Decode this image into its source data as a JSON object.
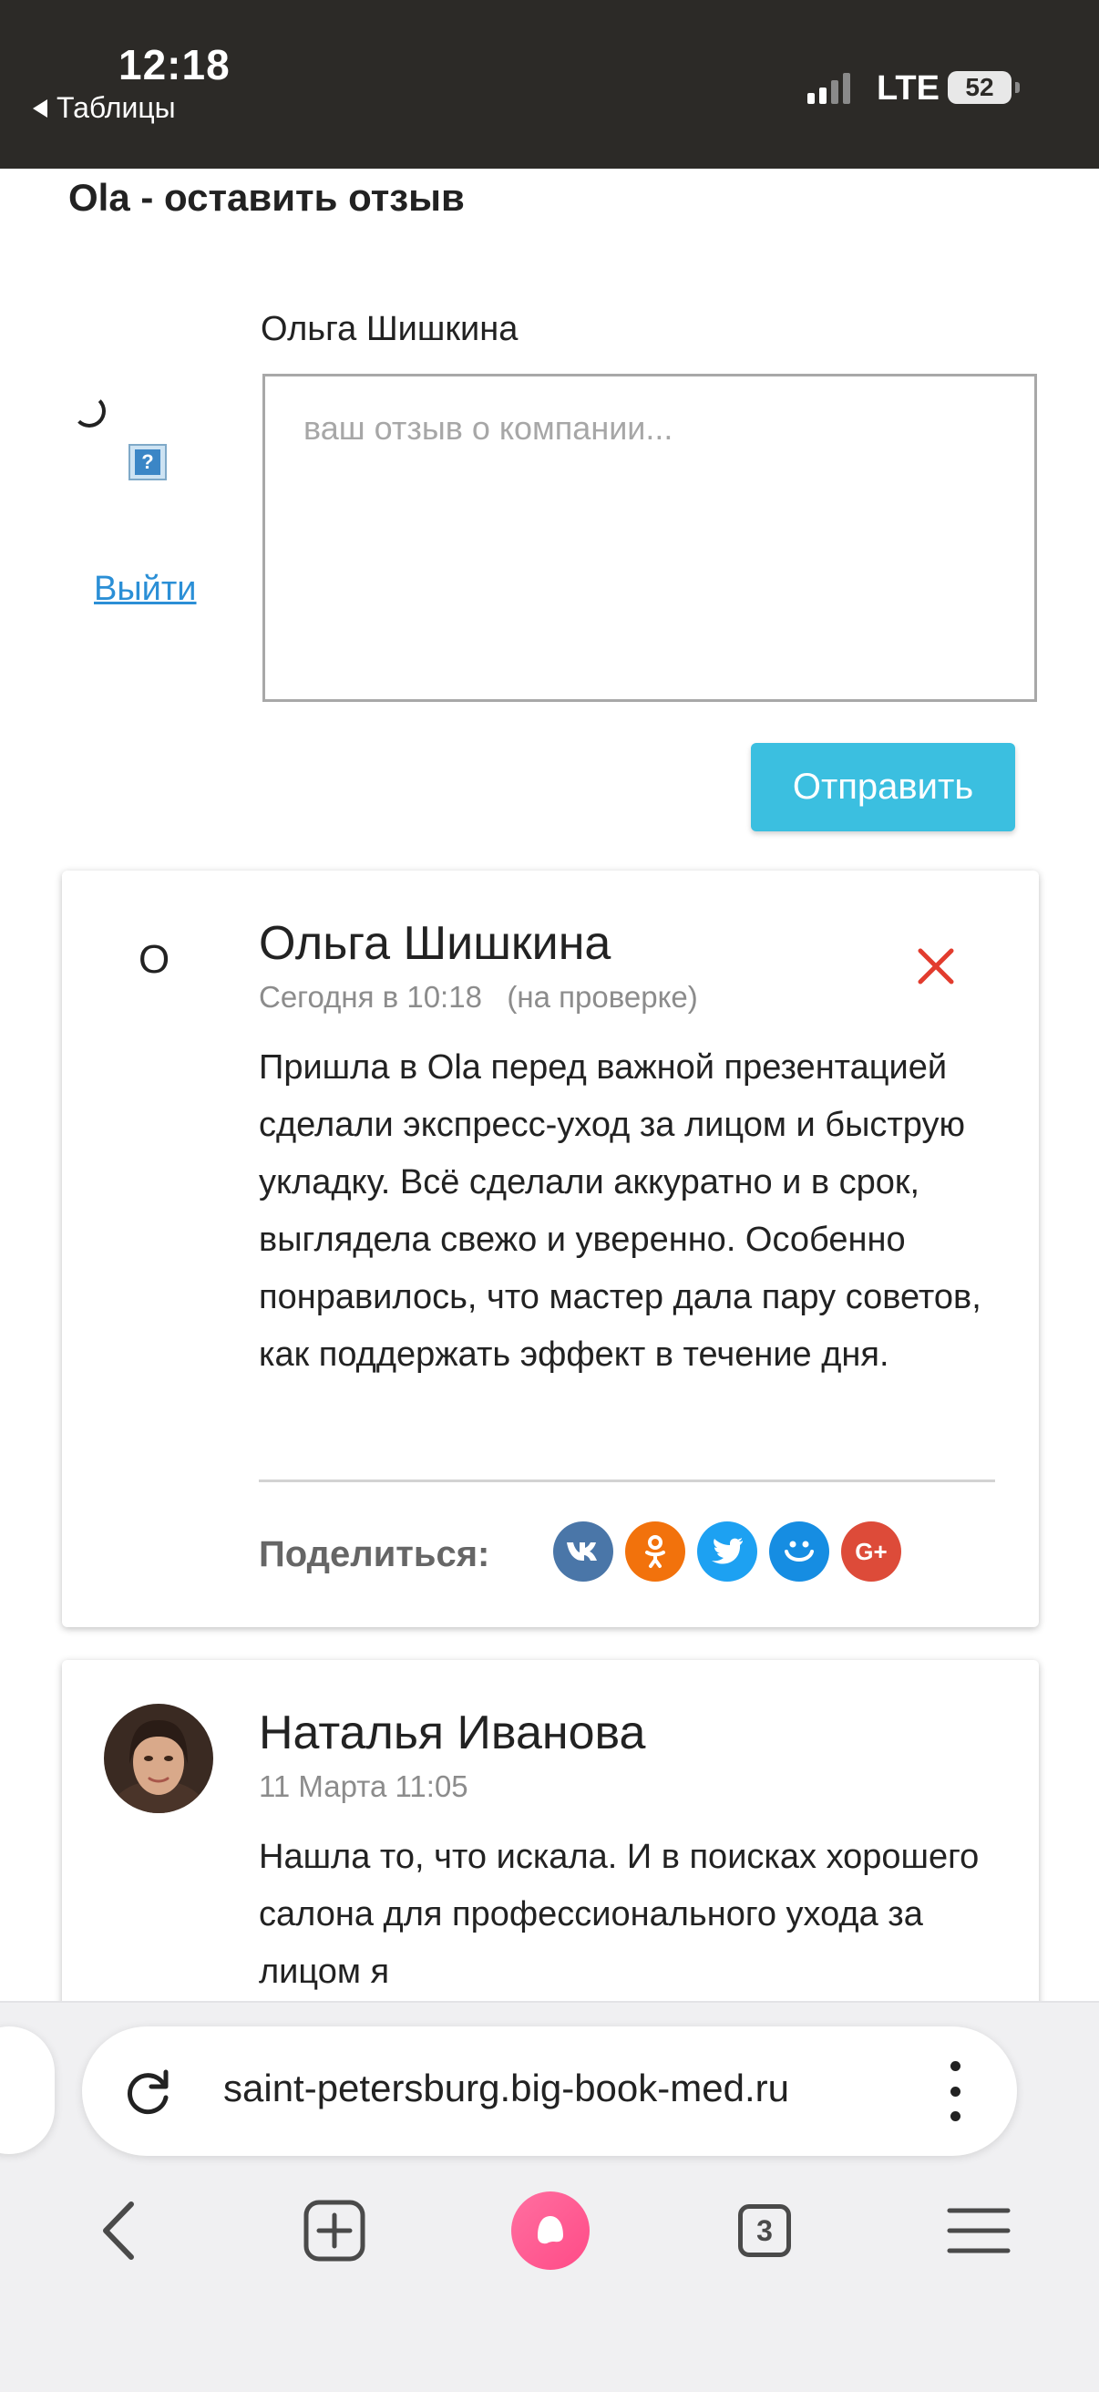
{
  "status_bar": {
    "time": "12:18",
    "back_label": "Таблицы",
    "network": "LTE",
    "battery": "52"
  },
  "page": {
    "title": "Ola - оставить отзыв",
    "form": {
      "user_name": "Ольга Шишкина",
      "placeholder": "ваш отзыв о компании...",
      "logout_label": "Выйти",
      "submit_label": "Отправить"
    },
    "reviews": [
      {
        "avatar_letter": "О",
        "author": "Ольга Шишкина",
        "meta": "Сегодня в 10:18   (на проверке)",
        "text": "Пришла в Ola перед важной презентацией сделали экспресс-уход за лицом и быструю укладку. Всё сделали аккуратно и в срок, выглядела свежо и уверенно. Особенно понравилось, что мастер дала пару советов, как поддержать эффект в течение дня.",
        "share_label": "Поделиться:"
      },
      {
        "author": "Наталья Иванова",
        "meta": "11 Марта 11:05",
        "text": "Нашла то, что искала. И в поисках хорошего салона для профессионального ухода за лицом я"
      }
    ],
    "share_buttons": [
      {
        "name": "vk",
        "color": "#4a76a8",
        "label": "vk"
      },
      {
        "name": "odnoklassniki",
        "color": "#f2720c",
        "label": "ok"
      },
      {
        "name": "twitter",
        "color": "#1da1f2",
        "label": "tw"
      },
      {
        "name": "moi-mir",
        "color": "#168de2",
        "label": "mm"
      },
      {
        "name": "google-plus",
        "color": "#dd4b39",
        "label": "G+"
      }
    ]
  },
  "browser": {
    "url": "saint-petersburg.big-book-med.ru",
    "tabs_count": "3"
  }
}
